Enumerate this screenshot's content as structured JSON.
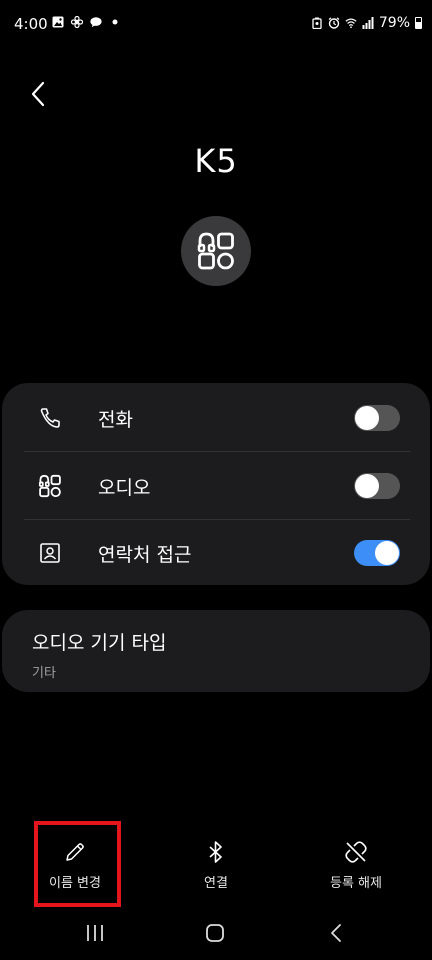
{
  "status_bar": {
    "time": "4:00",
    "battery_percent": "79%",
    "battery_level": 0.79,
    "left_icons": [
      "gallery-icon",
      "pinwheel-icon",
      "chat-bubble-icon",
      "dot-icon"
    ],
    "right_icons": [
      "lock-battery-icon",
      "alarm-icon",
      "wifi-icon",
      "signal-icon",
      "battery-icon"
    ]
  },
  "header": {
    "back_icon": "chevron-left-icon",
    "device_name": "K5",
    "device_icon": "audio-device-icon"
  },
  "permissions": {
    "items": [
      {
        "label": "전화",
        "icon": "phone-icon",
        "enabled": false
      },
      {
        "label": "오디오",
        "icon": "audio-device-icon",
        "enabled": false
      },
      {
        "label": "연락처 접근",
        "icon": "contact-card-icon",
        "enabled": true
      }
    ]
  },
  "device_type": {
    "title": "오디오 기기 타입",
    "value": "기타"
  },
  "actions": {
    "rename_label": "이름 변경",
    "connect_label": "연결",
    "unregister_label": "등록 해제"
  },
  "nav": {
    "items": [
      "recents-icon",
      "home-icon",
      "back-icon"
    ]
  },
  "colors": {
    "background": "#000000",
    "card": "#1c1c1e",
    "toggle_on": "#3e8ef7",
    "toggle_off": "#555555",
    "highlight": "#e4161b"
  }
}
